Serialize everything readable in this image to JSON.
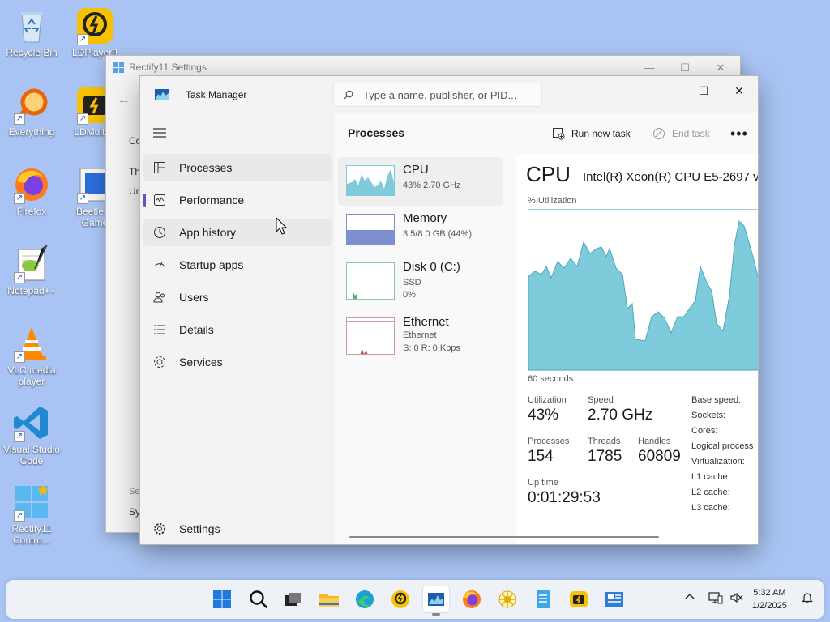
{
  "desktop": {
    "icons": [
      {
        "label": "Recycle Bin"
      },
      {
        "label": "LDPlayer9"
      },
      {
        "label": "Everything"
      },
      {
        "label": "LDMultiPl"
      },
      {
        "label": "Firefox"
      },
      {
        "label": "Beetle R Game"
      },
      {
        "label": "Notepad++"
      },
      {
        "label": "VLC media player"
      },
      {
        "label": "Visual Studio Code"
      },
      {
        "label": "Rectify11 Contro..."
      }
    ]
  },
  "rectify_window": {
    "title": "Rectify11 Settings",
    "side_texts": [
      "Co",
      "Th",
      "Ur",
      "Se",
      "Sy"
    ]
  },
  "task_manager": {
    "title": "Task Manager",
    "search_placeholder": "Type a name, publisher, or PID...",
    "nav": [
      {
        "label": "Processes",
        "icon": "grid-icon"
      },
      {
        "label": "Performance",
        "icon": "performance-icon"
      },
      {
        "label": "App history",
        "icon": "history-icon"
      },
      {
        "label": "Startup apps",
        "icon": "startup-icon"
      },
      {
        "label": "Users",
        "icon": "users-icon"
      },
      {
        "label": "Details",
        "icon": "details-icon"
      },
      {
        "label": "Services",
        "icon": "services-icon"
      }
    ],
    "settings_label": "Settings",
    "header": "Processes",
    "commands": {
      "run_new_task": "Run new task",
      "end_task": "End task"
    },
    "perf_items": [
      {
        "name": "CPU",
        "line1": "43%  2.70 GHz",
        "line2": ""
      },
      {
        "name": "Memory",
        "line1": "3.5/8.0 GB (44%)",
        "line2": ""
      },
      {
        "name": "Disk 0 (C:)",
        "line1": "SSD",
        "line2": "0%"
      },
      {
        "name": "Ethernet",
        "line1": "Ethernet",
        "line2": "S: 0  R: 0 Kbps"
      }
    ],
    "cpu_detail": {
      "title": "CPU",
      "model": "Intel(R) Xeon(R) CPU E5-2697 v",
      "graph_label": "% Utilization",
      "graph_time": "60 seconds",
      "stats": {
        "utilization_label": "Utilization",
        "utilization": "43%",
        "speed_label": "Speed",
        "speed": "2.70 GHz",
        "processes_label": "Processes",
        "processes": "154",
        "threads_label": "Threads",
        "threads": "1785",
        "handles_label": "Handles",
        "handles": "60809",
        "uptime_label": "Up time",
        "uptime": "0:01:29:53"
      },
      "specs": [
        "Base speed:",
        "Sockets:",
        "Cores:",
        "Logical process",
        "Virtualization:",
        "L1 cache:",
        "L2 cache:",
        "L3 cache:"
      ]
    }
  },
  "taskbar": {
    "clock_time": "5:32 AM",
    "clock_date": "1/2/2025"
  },
  "colors": {
    "accent": "#5a57c5",
    "cpu_graph": "#7ecbdb",
    "memory_graph": "#7e8fcf"
  }
}
